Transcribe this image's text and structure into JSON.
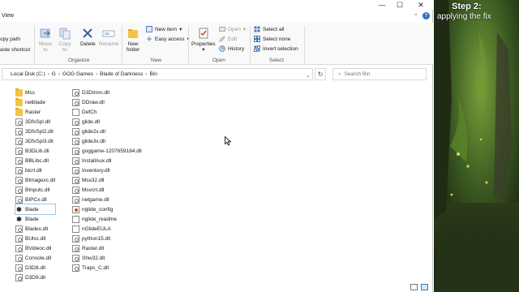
{
  "window": {
    "menu_view": "View",
    "buttons": {
      "minimize": "—",
      "maximize": "☐",
      "close": "✕"
    },
    "ribbon_collapse": "⌃",
    "help": "?"
  },
  "ribbon": {
    "clipboard": {
      "copy_path": "opy path",
      "paste_shortcut": "aste shortcut"
    },
    "organize": {
      "label": "Organize",
      "move_to": [
        "Move",
        "to"
      ],
      "copy_to": [
        "Copy",
        "to"
      ],
      "delete": "Delete",
      "rename": "Rename"
    },
    "new": {
      "label": "New",
      "new_folder": [
        "New",
        "folder"
      ],
      "new_item": "New item",
      "easy_access": "Easy access"
    },
    "open": {
      "label": "Open",
      "properties": "Properties",
      "open": "Open",
      "edit": "Edit",
      "history": "History"
    },
    "select": {
      "label": "Select",
      "select_all": "Select all",
      "select_none": "Select none",
      "invert_selection": "Invert selection"
    }
  },
  "address": {
    "crumbs": [
      "Local Disk (C:)",
      "G",
      "GOG Games",
      "Blade of Darkness",
      "Bin"
    ],
    "search_placeholder": "Search Bin"
  },
  "files": {
    "col1": [
      {
        "name": "Mss",
        "type": "folder"
      },
      {
        "name": "netblade",
        "type": "folder"
      },
      {
        "name": "Raster",
        "type": "folder"
      },
      {
        "name": "3DfxSpl.dll",
        "type": "dll"
      },
      {
        "name": "3DfxSpl2.dll",
        "type": "dll"
      },
      {
        "name": "3DfxSpl3.dll",
        "type": "dll"
      },
      {
        "name": "B3DLib.dll",
        "type": "dll"
      },
      {
        "name": "BBLibc.dll",
        "type": "dll"
      },
      {
        "name": "bicrt.dll",
        "type": "dll"
      },
      {
        "name": "BImagexc.dll",
        "type": "dll"
      },
      {
        "name": "BInputc.dll",
        "type": "dll"
      },
      {
        "name": "BIPCx.dll",
        "type": "dll"
      },
      {
        "name": "Blade",
        "type": "exe"
      },
      {
        "name": "Blade",
        "type": "exe"
      },
      {
        "name": "Bladex.dll",
        "type": "dll"
      },
      {
        "name": "BUlxc.dll",
        "type": "dll"
      },
      {
        "name": "BVideoc.dll",
        "type": "dll"
      },
      {
        "name": "Console.dll",
        "type": "dll"
      },
      {
        "name": "D3D8.dll",
        "type": "dll"
      },
      {
        "name": "D3D9.dll",
        "type": "dll"
      }
    ],
    "col2": [
      {
        "name": "D3DImm.dll",
        "type": "dll"
      },
      {
        "name": "DDraw.dll",
        "type": "dll"
      },
      {
        "name": "DefCh",
        "type": "txt"
      },
      {
        "name": "glide.dll",
        "type": "dll"
      },
      {
        "name": "glide2x.dll",
        "type": "dll"
      },
      {
        "name": "glide3x.dll",
        "type": "dll"
      },
      {
        "name": "goggame-1207659184.dll",
        "type": "dll"
      },
      {
        "name": "InstallAux.dll",
        "type": "dll"
      },
      {
        "name": "Inventory.dll",
        "type": "dll"
      },
      {
        "name": "Mss32.dll",
        "type": "dll"
      },
      {
        "name": "Msvcrt.dll",
        "type": "dll"
      },
      {
        "name": "netgame.dll",
        "type": "dll"
      },
      {
        "name": "nglide_config",
        "type": "cfg"
      },
      {
        "name": "nglide_readme",
        "type": "txt"
      },
      {
        "name": "nGlideEULA",
        "type": "txt"
      },
      {
        "name": "python15.dll",
        "type": "dll"
      },
      {
        "name": "Raster.dll",
        "type": "dll"
      },
      {
        "name": "Shw32.dll",
        "type": "dll"
      },
      {
        "name": "Traps_C.dll",
        "type": "dll"
      }
    ]
  },
  "overlay": {
    "step_title": "Step 2:",
    "step_subtitle": "applying the fix"
  },
  "colors": {
    "folder": "#f4c542",
    "accent": "#2b6cc4",
    "selection_border": "#99c9ef"
  }
}
